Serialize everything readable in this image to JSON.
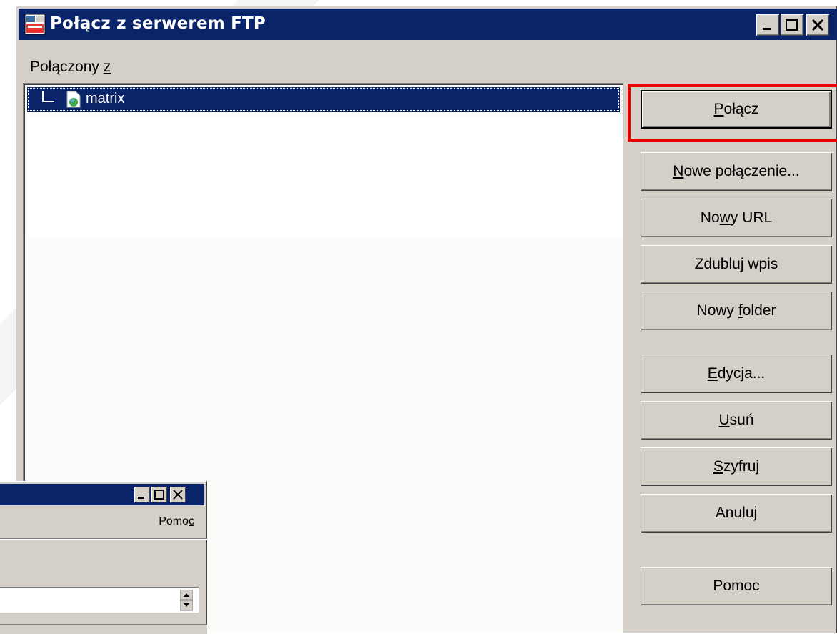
{
  "dialog": {
    "title": "Połącz z serwerem FTP",
    "connected_label_prefix": "Połączony ",
    "connected_label_key": "z",
    "list": {
      "items": [
        {
          "label": "matrix",
          "selected": true
        }
      ]
    },
    "buttons": {
      "connect": {
        "pre": "",
        "key": "P",
        "post": "ołącz"
      },
      "new_connection": {
        "pre": "",
        "key": "N",
        "post": "owe połączenie..."
      },
      "new_url": {
        "pre": "No",
        "key": "w",
        "post": "y URL"
      },
      "duplicate": {
        "pre": "Zdubluj wpis",
        "key": "",
        "post": ""
      },
      "new_folder": {
        "pre": "Nowy ",
        "key": "f",
        "post": "older"
      },
      "edit": {
        "pre": "",
        "key": "E",
        "post": "dycja..."
      },
      "delete": {
        "pre": "",
        "key": "U",
        "post": "suń"
      },
      "encrypt": {
        "pre": "",
        "key": "S",
        "post": "zyfruj"
      },
      "cancel": {
        "pre": "Anuluj",
        "key": "",
        "post": ""
      },
      "help": {
        "pre": "Pomoc",
        "key": "",
        "post": ""
      }
    },
    "colors": {
      "titlebar": "#0a246a",
      "face": "#d4d0c8",
      "highlight": "#e60000"
    }
  },
  "background_window": {
    "menu_help_prefix": "Pomo",
    "menu_help_key": "c"
  }
}
